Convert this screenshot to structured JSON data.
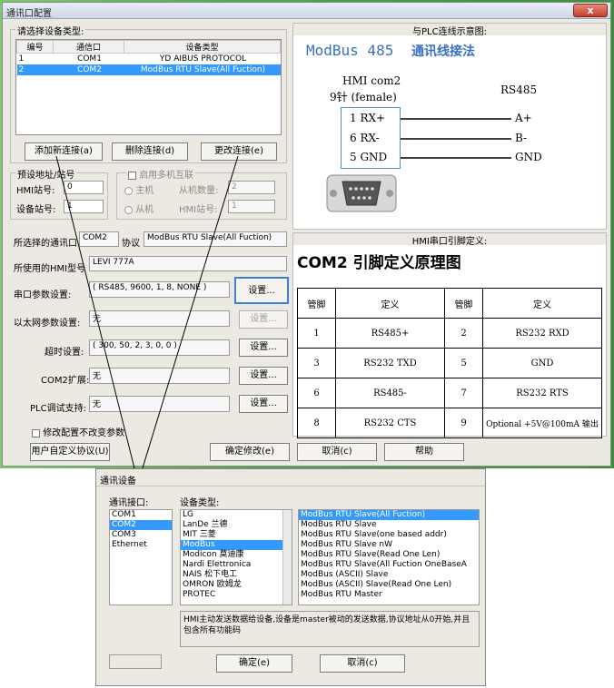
{
  "main": {
    "title": "通讯口配置",
    "close_label": "x",
    "device_group": {
      "label": "请选择设备类型:",
      "columns": [
        "编号",
        "通信口",
        "设备类型"
      ],
      "rows": [
        {
          "id": "1",
          "port": "COM1",
          "type": "YD AIBUS PROTOCOL"
        },
        {
          "id": "2",
          "port": "COM2",
          "type": "ModBus RTU Slave(All Fuction)"
        }
      ],
      "add": "添加新连接(a)",
      "delete": "删除连接(d)",
      "change": "更改连接(e)"
    },
    "station_group": {
      "label": "预设地址/站号",
      "hmi_label": "HMI站号:",
      "hmi_value": "0",
      "dev_label": "设备站号:",
      "dev_value": "1"
    },
    "multi_group": {
      "label": "启用多机互联",
      "master": "主机",
      "slave": "从机",
      "slave_count_label": "从机数量:",
      "slave_count_value": "2",
      "hmi_station_label": "HMI站号:",
      "hmi_station_value": "1"
    },
    "port_row": {
      "label": "所选择的通讯口",
      "value": "COM2",
      "proto_label": "协议",
      "proto_value": "ModBus RTU Slave(All Fuction)"
    },
    "hmi_model": {
      "label": "所使用的HMI型号",
      "value": "LEVI 777A"
    },
    "serial": {
      "label": "串口参数设置:",
      "value": "( RS485, 9600, 1, 8, NONE )",
      "btn": "设置..."
    },
    "ethernet": {
      "label": "以太网参数设置:",
      "value": "无",
      "btn": "设置..."
    },
    "timeout": {
      "label": "超时设置:",
      "value": "( 300, 50, 2, 3, 0, 0 )",
      "btn": "设置..."
    },
    "com2ext": {
      "label": "COM2扩展:",
      "value": "无",
      "btn": "设置..."
    },
    "plcdebug": {
      "label": "PLC调试支持:",
      "value": "无",
      "btn": "设置..."
    },
    "nochange": "修改配置不改变参数",
    "custom_btn": "用户自定义协议(U)",
    "ok_btn": "确定修改(e)",
    "cancel_btn": "取消(c)",
    "help_btn": "帮助",
    "wiring": {
      "header": "与PLC连线示意图:",
      "title1": "ModBus 485",
      "title2": "通讯线接法",
      "hmi_line1": "HMI com2",
      "hmi_line2": "9针 (female)",
      "rs485": "RS485",
      "pins": [
        {
          "left": "1 RX+",
          "right": "A+"
        },
        {
          "left": "6 RX-",
          "right": "B-"
        },
        {
          "left": "5 GND",
          "right": "GND"
        }
      ]
    },
    "pinout": {
      "header": "HMI串口引脚定义:",
      "title": "COM2 引脚定义原理图",
      "headers": [
        "管脚",
        "定义",
        "管脚",
        "定义"
      ],
      "rows": [
        [
          "1",
          "RS485+",
          "2",
          "RS232 RXD"
        ],
        [
          "3",
          "RS232 TXD",
          "5",
          "GND"
        ],
        [
          "6",
          "RS485-",
          "7",
          "RS232 RTS"
        ],
        [
          "8",
          "RS232 CTS",
          "9",
          "Optional +5V@100mA 输出"
        ]
      ]
    }
  },
  "dialog": {
    "title": "通讯设备",
    "port_label": "通讯接口:",
    "ports": [
      "COM1",
      "COM2",
      "COM3",
      "Ethernet"
    ],
    "type_label": "设备类型:",
    "types": [
      "LG",
      "LanDe 兰德",
      "MIT 三菱",
      "ModBus",
      "Modicon 莫迪康",
      "Nardi Elettronica",
      "NAIS 松下电工",
      "OMRON 欧姆龙",
      "PROTEC"
    ],
    "protocols": [
      "ModBus RTU Slave(All Fuction)",
      "ModBus RTU Slave",
      "ModBus RTU Slave(one based addr)",
      "ModBus RTU Slave nW",
      "ModBus RTU Slave(Read One Len)",
      "ModBus RTU Slave(All Fuction OneBaseA",
      "ModBus (ASCII) Slave",
      "ModBus (ASCII) Slave(Read One Len)",
      "ModBus RTU Master"
    ],
    "desc": "HMI主动发送数据给设备,设备是master被动的发送数据,协议地址从0开始,并且包含所有功能码",
    "ok": "确定(e)",
    "cancel": "取消(c)"
  }
}
